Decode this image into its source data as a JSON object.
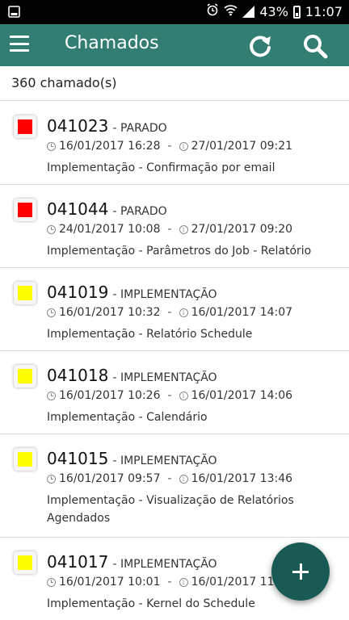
{
  "status_bar": {
    "battery_percent": "43%",
    "time": "11:07",
    "icons": [
      "image-icon",
      "alarm-icon",
      "wifi-icon",
      "signal-icon",
      "battery-icon"
    ]
  },
  "app_bar": {
    "title": "Chamados",
    "icons": [
      "menu-icon",
      "refresh-icon",
      "search-icon"
    ]
  },
  "summary": {
    "count_label": "360 chamado(s)"
  },
  "tickets": [
    {
      "id": "041023",
      "status": "- PARADO",
      "color": "#ff0000",
      "opened": "16/01/2017 16:28",
      "due": "27/01/2017 09:21",
      "description": "Implementação - Confirmação por email"
    },
    {
      "id": "041044",
      "status": "- PARADO",
      "color": "#ff0000",
      "opened": "24/01/2017 10:08",
      "due": "27/01/2017 09:20",
      "description": "Implementação - Parâmetros do Job - Relatório"
    },
    {
      "id": "041019",
      "status": "- IMPLEMENTAÇÃO",
      "color": "#ffff00",
      "opened": "16/01/2017 10:32",
      "due": "16/01/2017 14:07",
      "description": "Implementação - Relatório Schedule"
    },
    {
      "id": "041018",
      "status": "- IMPLEMENTAÇÃO",
      "color": "#ffff00",
      "opened": "16/01/2017 10:26",
      "due": "16/01/2017 14:06",
      "description": "Implementação - Calendário"
    },
    {
      "id": "041015",
      "status": "- IMPLEMENTAÇÃO",
      "color": "#ffff00",
      "opened": "16/01/2017 09:57",
      "due": "16/01/2017 13:46",
      "description": "Implementação - Visualização de Relatórios Agendados"
    },
    {
      "id": "041017",
      "status": "- IMPLEMENTAÇÃO",
      "color": "#ffff00",
      "opened": "16/01/2017 10:01",
      "due": "16/01/2017 11:48",
      "description": "Implementação - Kernel do Schedule"
    }
  ],
  "separator": "-",
  "fab": {
    "icon": "plus-icon"
  },
  "colors": {
    "app_bar": "#327e72",
    "fab": "#1a5a55",
    "stopped": "#ff0000",
    "implementation": "#ffff00"
  }
}
